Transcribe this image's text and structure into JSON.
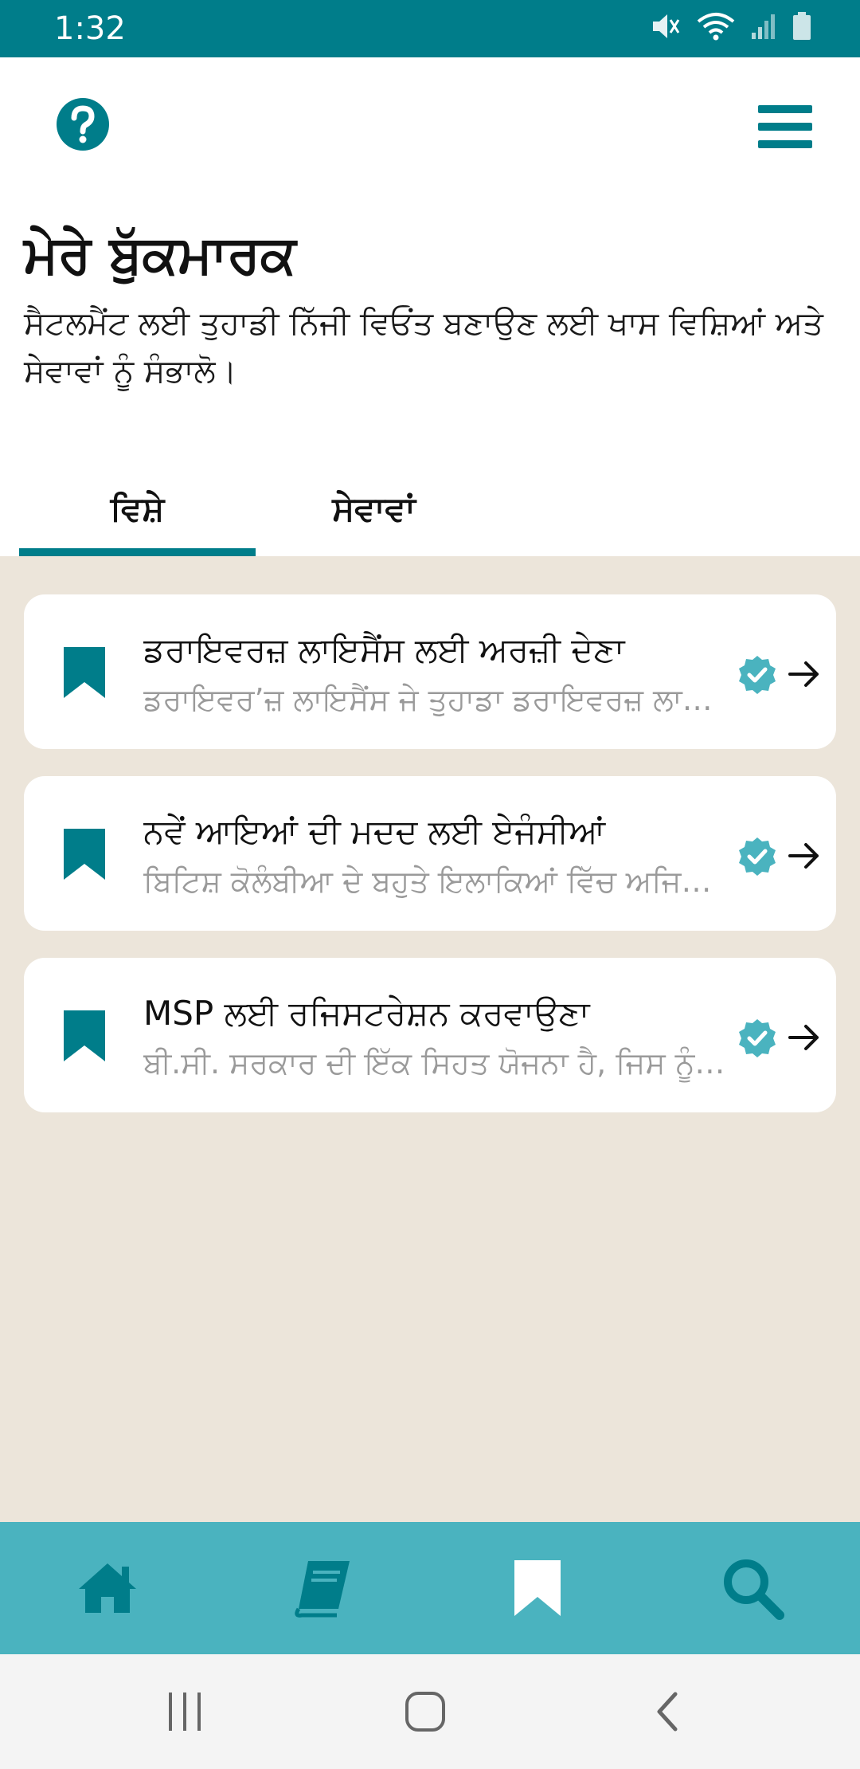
{
  "status_bar": {
    "time": "1:32",
    "icons": [
      "mute-icon",
      "wifi-icon",
      "signal-icon",
      "battery-icon"
    ]
  },
  "header": {
    "title": "ਮੇਰੇ ਬੁੱਕਮਾਰਕ",
    "subtitle": "ਸੈਟਲਮੈਂਟ ਲਈ ਤੁਹਾਡੀ ਨਿੱਜੀ ਵਿਓਂਤ ਬਣਾਉਣ ਲਈ ਖਾਸ ਵਿਸ਼ਿਆਂ ਅਤੇ ਸੇਵਾਵਾਂ ਨੂੰ ਸੰਭਾਲੋ।",
    "icons": [
      "help-icon",
      "hamburger-menu-icon"
    ]
  },
  "tabs": [
    {
      "label": "ਵਿਸ਼ੇ",
      "selected": true
    },
    {
      "label": "ਸੇਵਾਵਾਂ",
      "selected": false
    }
  ],
  "bookmarks": [
    {
      "title": "ਡਰਾਇਵਰਜ਼ ਲਾਇਸੈਂਸ ਲਈ ਅਰਜ਼ੀ ਦੇਣਾ",
      "description": "ਡਰਾਇਵਰ’ਜ਼ ਲਾਇਸੈਂਸ  ਜੇ ਤੁਹਾਡਾ ਡਰਾਇਵਰਜ਼ ਲਾ…"
    },
    {
      "title": "ਨਵੇਂ ਆਇਆਂ ਦੀ ਮਦਦ ਲਈ ਏਜੰਸੀਆਂ",
      "description": "ਬਿਟਿਸ਼ ਕੋਲੰਬੀਆ ਦੇ ਬਹੁਤੇ ਇਲਾਕਿਆਂ ਵਿੱਚ ਅਜਿ…"
    },
    {
      "title": "MSP ਲਈ ਰਜਿਸਟਰੇਸ਼ਨ ਕਰਵਾਉਣਾ",
      "description": "ਬੀ.ਸੀ. ਸਰਕਾਰ ਦੀ ਇੱਕ ਸਿਹਤ ਯੋਜਨਾ ਹੈ, ਜਿਸ ਨੂੰ…"
    }
  ],
  "bottom_nav": {
    "items": [
      "home-icon",
      "book-icon",
      "bookmark-icon",
      "search-icon"
    ],
    "active": "bookmark-icon"
  },
  "system_nav": [
    "recents-icon",
    "home-button-icon",
    "back-icon"
  ],
  "colors": {
    "primary": "#007d8a",
    "nav_background": "#4ab3bf",
    "content_background": "#ece5da",
    "verified_badge": "#4ab3bf",
    "secondary_text": "#9a9a9a"
  }
}
